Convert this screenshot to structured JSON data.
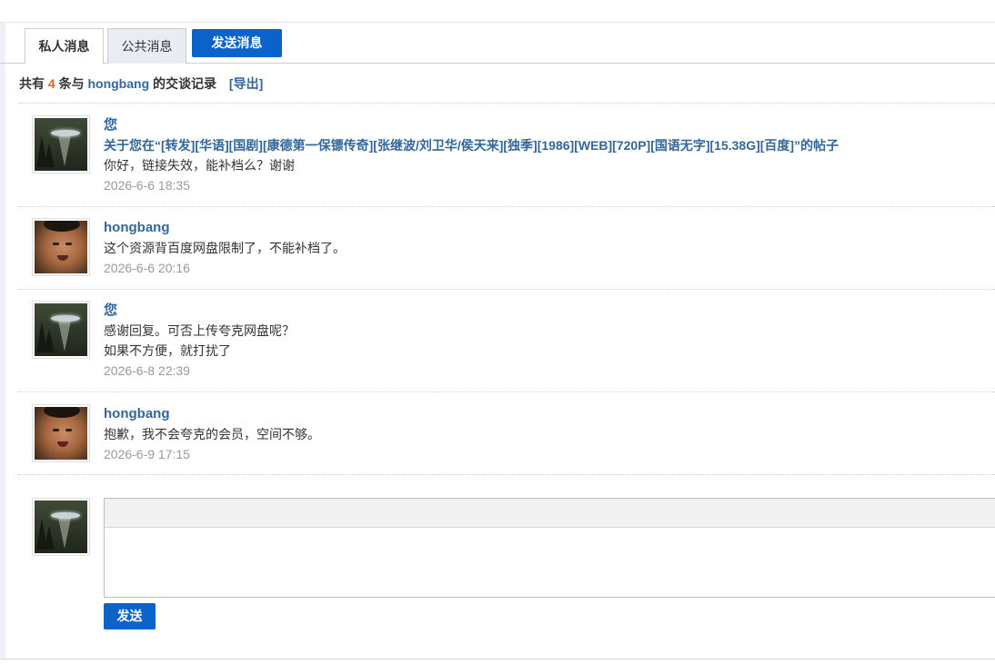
{
  "tabs": {
    "private_label": "私人消息",
    "public_label": "公共消息",
    "send_label": "发送消息"
  },
  "summary": {
    "prefix": "共有",
    "count": "4",
    "mid": "条与",
    "name": "hongbang",
    "suffix": "的交谈记录",
    "export_label": "[导出]"
  },
  "messages": [
    {
      "who": "您",
      "avatar": "ufo-avatar",
      "subject": "关于您在“[转发][华语][国剧][康德第一保镖传奇][张继波/刘卫华/侯天来][独季][1986][WEB][720P][国语无字][15.38G][百度]”的帖子",
      "lines": [
        "你好，链接失效，能补档么？谢谢"
      ],
      "time": "2026-6-6 18:35"
    },
    {
      "who": "hongbang",
      "avatar": "face-avatar",
      "lines": [
        "这个资源背百度网盘限制了，不能补档了。"
      ],
      "time": "2026-6-6 20:16"
    },
    {
      "who": "您",
      "avatar": "ufo-avatar",
      "lines": [
        "感谢回复。可否上传夸克网盘呢？",
        "如果不方便，就打扰了"
      ],
      "time": "2026-6-8 22:39"
    },
    {
      "who": "hongbang",
      "avatar": "face-avatar",
      "lines": [
        "抱歉，我不会夸克的会员，空间不够。"
      ],
      "time": "2026-6-9 17:15"
    }
  ],
  "reply": {
    "value": "",
    "send_label": "发送"
  }
}
